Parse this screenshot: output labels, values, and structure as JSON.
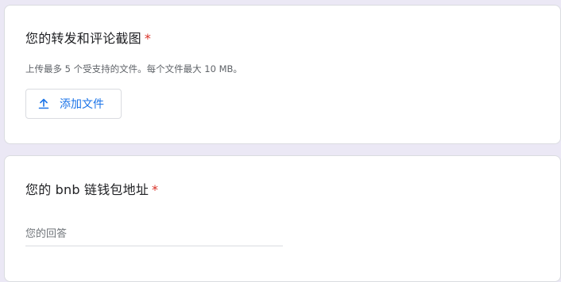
{
  "questions": [
    {
      "title": "您的转发和评论截图",
      "required_mark": "*",
      "help_text": "上传最多 5 个受支持的文件。每个文件最大 10 MB。",
      "upload_button_label": "添加文件",
      "upload_icon": "upload-icon"
    },
    {
      "title": "您的 bnb 链钱包地址",
      "required_mark": "*",
      "answer_placeholder": "您的回答",
      "answer_value": ""
    }
  ],
  "colors": {
    "page_background": "#ebe8f5",
    "card_background": "#ffffff",
    "required": "#d93025",
    "accent": "#1a73e8",
    "text_primary": "#202124",
    "text_secondary": "#5f6368",
    "border": "#dadce0"
  }
}
